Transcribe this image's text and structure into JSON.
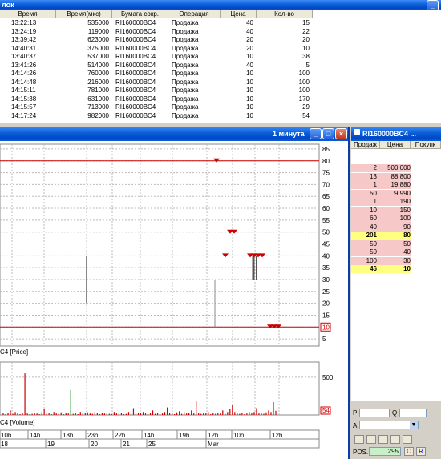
{
  "top_window": {
    "title": "лок",
    "columns": [
      "Время",
      "Время(мкс)",
      "Бумага сокр.",
      "Операция",
      "Цена",
      "Кол-во"
    ],
    "rows": [
      [
        "13:22:13",
        "535000",
        "RI160000BC4",
        "Продажа",
        "40",
        "15"
      ],
      [
        "13:24:19",
        "119000",
        "RI160000BC4",
        "Продажа",
        "40",
        "22"
      ],
      [
        "13:39:42",
        "623000",
        "RI160000BC4",
        "Продажа",
        "20",
        "20"
      ],
      [
        "14:40:31",
        "375000",
        "RI160000BC4",
        "Продажа",
        "20",
        "10"
      ],
      [
        "13:40:37",
        "537000",
        "RI160000BC4",
        "Продажа",
        "10",
        "38"
      ],
      [
        "13:41:26",
        "514000",
        "RI160000BC4",
        "Продажа",
        "40",
        "5"
      ],
      [
        "14:14:26",
        "760000",
        "RI160000BC4",
        "Продажа",
        "10",
        "100"
      ],
      [
        "14:14:48",
        "216000",
        "RI160000BC4",
        "Продажа",
        "10",
        "100"
      ],
      [
        "14:15:11",
        "781000",
        "RI160000BC4",
        "Продажа",
        "10",
        "100"
      ],
      [
        "14:15:38",
        "631000",
        "RI160000BC4",
        "Продажа",
        "10",
        "170"
      ],
      [
        "14:15:57",
        "713000",
        "RI160000BC4",
        "Продажа",
        "10",
        "29"
      ],
      [
        "14:17:24",
        "982000",
        "RI160000BC4",
        "Продажа",
        "10",
        "54"
      ]
    ]
  },
  "chart_window": {
    "title": "1 минута",
    "price_label": "C4 [Price]",
    "volume_label": "C4 [Volume]",
    "price_axis_ticks": [
      "85",
      "80",
      "75",
      "70",
      "65",
      "60",
      "55",
      "50",
      "45",
      "40",
      "35",
      "30",
      "25",
      "20",
      "15",
      "10",
      "5"
    ],
    "price_marker": "10",
    "volume_axis_ticks": [
      "500"
    ],
    "volume_marker": "54",
    "time_row1": [
      "10h",
      "14h",
      "18h",
      "23h",
      "22h",
      "14h",
      "19h",
      "12h",
      "10h",
      "12h",
      "14h"
    ],
    "time_row2": [
      "18",
      "19",
      "20",
      "21",
      "25",
      "Mar"
    ]
  },
  "chart_data": [
    {
      "type": "bar",
      "title": "C4 [Price]",
      "ylim": [
        2,
        87
      ],
      "horizontal_lines": [
        80,
        10
      ],
      "sell_markers": [
        {
          "x": "14h",
          "y": 80
        },
        {
          "x": "12h",
          "y": 50
        },
        {
          "x": "10h",
          "y": 40
        },
        {
          "x": "12h",
          "y": 40
        },
        {
          "x": "14h",
          "y": 10
        }
      ]
    },
    {
      "type": "bar",
      "title": "C4 [Volume]",
      "ylim": [
        0,
        700
      ],
      "values": [
        30,
        10,
        25,
        60,
        15,
        40,
        20,
        10,
        25,
        550,
        20,
        10,
        15,
        30,
        20,
        10,
        35,
        80,
        15,
        25,
        10,
        40,
        20,
        15,
        35,
        10,
        25,
        20,
        330,
        15,
        25,
        10,
        40,
        20,
        30,
        35,
        20,
        15,
        40,
        25,
        10,
        30,
        20,
        25,
        15,
        10,
        40,
        20,
        30,
        25,
        10,
        15,
        40,
        20,
        90,
        15,
        30,
        25,
        40,
        20,
        10,
        25,
        60,
        15,
        30,
        10,
        20,
        40,
        100,
        30,
        20,
        10,
        35,
        50,
        15,
        40,
        20,
        25,
        60,
        20,
        180,
        25,
        15,
        30,
        20,
        40,
        10,
        25,
        15,
        30,
        20,
        60,
        15,
        40,
        80,
        130,
        40,
        30,
        15,
        25,
        10,
        20,
        40,
        30,
        40,
        90,
        20,
        25,
        15,
        35,
        60,
        40,
        170,
        55
      ]
    }
  ],
  "order_book": {
    "title": "RI160000BC4 ...",
    "columns": [
      "Продаж",
      "Цена",
      "Покупк"
    ],
    "rows": [
      {
        "sell": "2",
        "price": "500 000",
        "buy": "",
        "kind": "ask"
      },
      {
        "sell": "13",
        "price": "88 800",
        "buy": "",
        "kind": "ask"
      },
      {
        "sell": "1",
        "price": "19 880",
        "buy": "",
        "kind": "ask"
      },
      {
        "sell": "50",
        "price": "9 990",
        "buy": "",
        "kind": "ask"
      },
      {
        "sell": "1",
        "price": "190",
        "buy": "",
        "kind": "ask"
      },
      {
        "sell": "10",
        "price": "150",
        "buy": "",
        "kind": "ask"
      },
      {
        "sell": "60",
        "price": "100",
        "buy": "",
        "kind": "ask"
      },
      {
        "sell": "40",
        "price": "90",
        "buy": "",
        "kind": "ask"
      },
      {
        "sell": "201",
        "price": "80",
        "buy": "",
        "kind": "best"
      },
      {
        "sell": "50",
        "price": "50",
        "buy": "",
        "kind": "ask"
      },
      {
        "sell": "50",
        "price": "40",
        "buy": "",
        "kind": "ask"
      },
      {
        "sell": "100",
        "price": "30",
        "buy": "",
        "kind": "ask"
      },
      {
        "sell": "46",
        "price": "10",
        "buy": "",
        "kind": "best"
      }
    ],
    "p_label": "P",
    "q_label": "Q",
    "a_label": "A",
    "pos_label": "POS.",
    "pos_value": "295",
    "c_button": "C",
    "r_button": "R"
  },
  "colors": {
    "ask_bg": "#f7c8c8",
    "best_bg": "#ffff80",
    "red": "#cc0000",
    "green": "#008000"
  }
}
